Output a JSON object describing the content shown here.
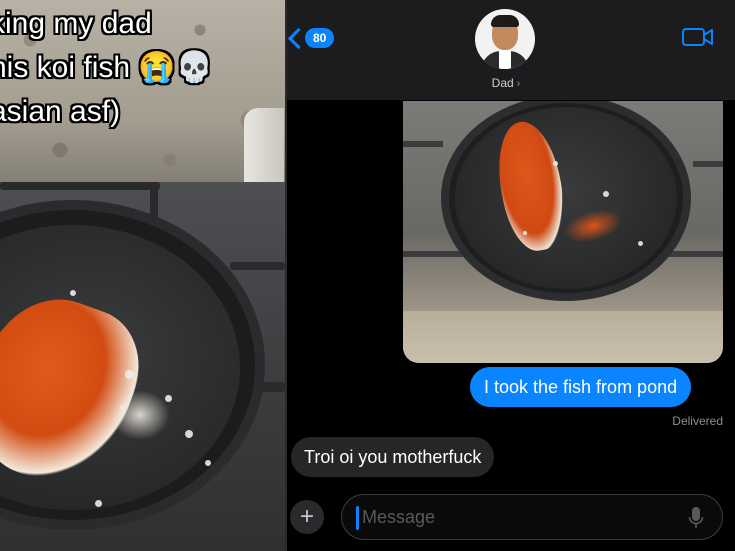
{
  "left_photo": {
    "caption_lines": [
      "king my dad",
      "his koi fish 😭💀",
      "asian asf)"
    ]
  },
  "imessage": {
    "back_badge": "80",
    "contact_name": "Dad",
    "messages": {
      "sent_text": "I took the fish from pond",
      "sent_status": "Delivered",
      "received_text": "Troi oi you motherfuck"
    },
    "compose": {
      "placeholder": "Message",
      "plus_symbol": "+"
    },
    "colors": {
      "accent": "#0a84ff",
      "sent_bubble": "#0a84ff",
      "received_bubble": "#262628",
      "background": "#000000",
      "header": "#1c1c1e"
    },
    "icons": [
      "chevron-left-icon",
      "video-camera-icon",
      "plus-icon",
      "microphone-icon"
    ]
  }
}
